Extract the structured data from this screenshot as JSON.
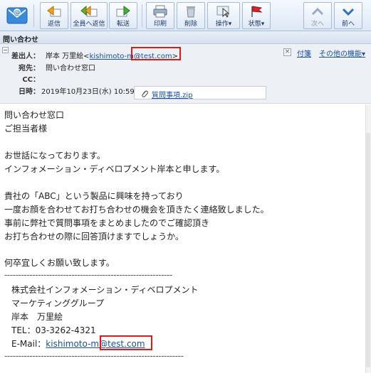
{
  "toolbar": {
    "reply": "返信",
    "reply_all": "全員へ返信",
    "forward": "転送",
    "print": "印刷",
    "delete": "削除",
    "actions": "操作▾",
    "status": "状態▾",
    "next": "次へ",
    "prev": "前へ"
  },
  "message_bar": {
    "title": "問い合わせ"
  },
  "header": {
    "from_label": "差出人：",
    "from_name": "岸本 万里絵<",
    "from_email": "kishimoto-m@test.com",
    "from_close": ">",
    "to_label": "宛先：",
    "to_value": "問い合わせ窓口",
    "cc_label": "CC：",
    "cc_value": "",
    "date_label": "日時：",
    "date_value": "2019年10月23日(水) 10:59",
    "attachment": "質問事項.zip",
    "flag_link": "付箋",
    "other_functions": "その他の機能▾"
  },
  "body": {
    "lines": [
      "問い合わせ窓口",
      "ご担当者様",
      "",
      "お世話になっております。",
      "インフォメーション・ディベロプメント岸本と申します。",
      "",
      "貴社の「ABC」という製品に興味を持っており",
      "一度お顔を合わせてお打ち合わせの機会を頂きたく連絡致しました。",
      "事前に弊社で質問事項をまとめましたのでご確認頂き",
      "お打ち合わせの際に回答頂けますでしょうか。",
      "",
      "何卒宜しくお願い致します。"
    ],
    "separator": "------------------------------------------------------------",
    "signature": {
      "company": "株式会社インフォメーション・ディベロプメント",
      "department": "マーケティンググループ",
      "name": "岸本　万里絵",
      "tel": "TEL：03-3262-4321",
      "email_label": "E-Mail：",
      "email": "kishimoto-m@test.com"
    },
    "separator_bottom": "----------------------------------------------------------------"
  },
  "colors": {
    "highlight_box": "#e01818",
    "link": "#1a4fa3",
    "toolbar_bg": "#dde8f5"
  }
}
